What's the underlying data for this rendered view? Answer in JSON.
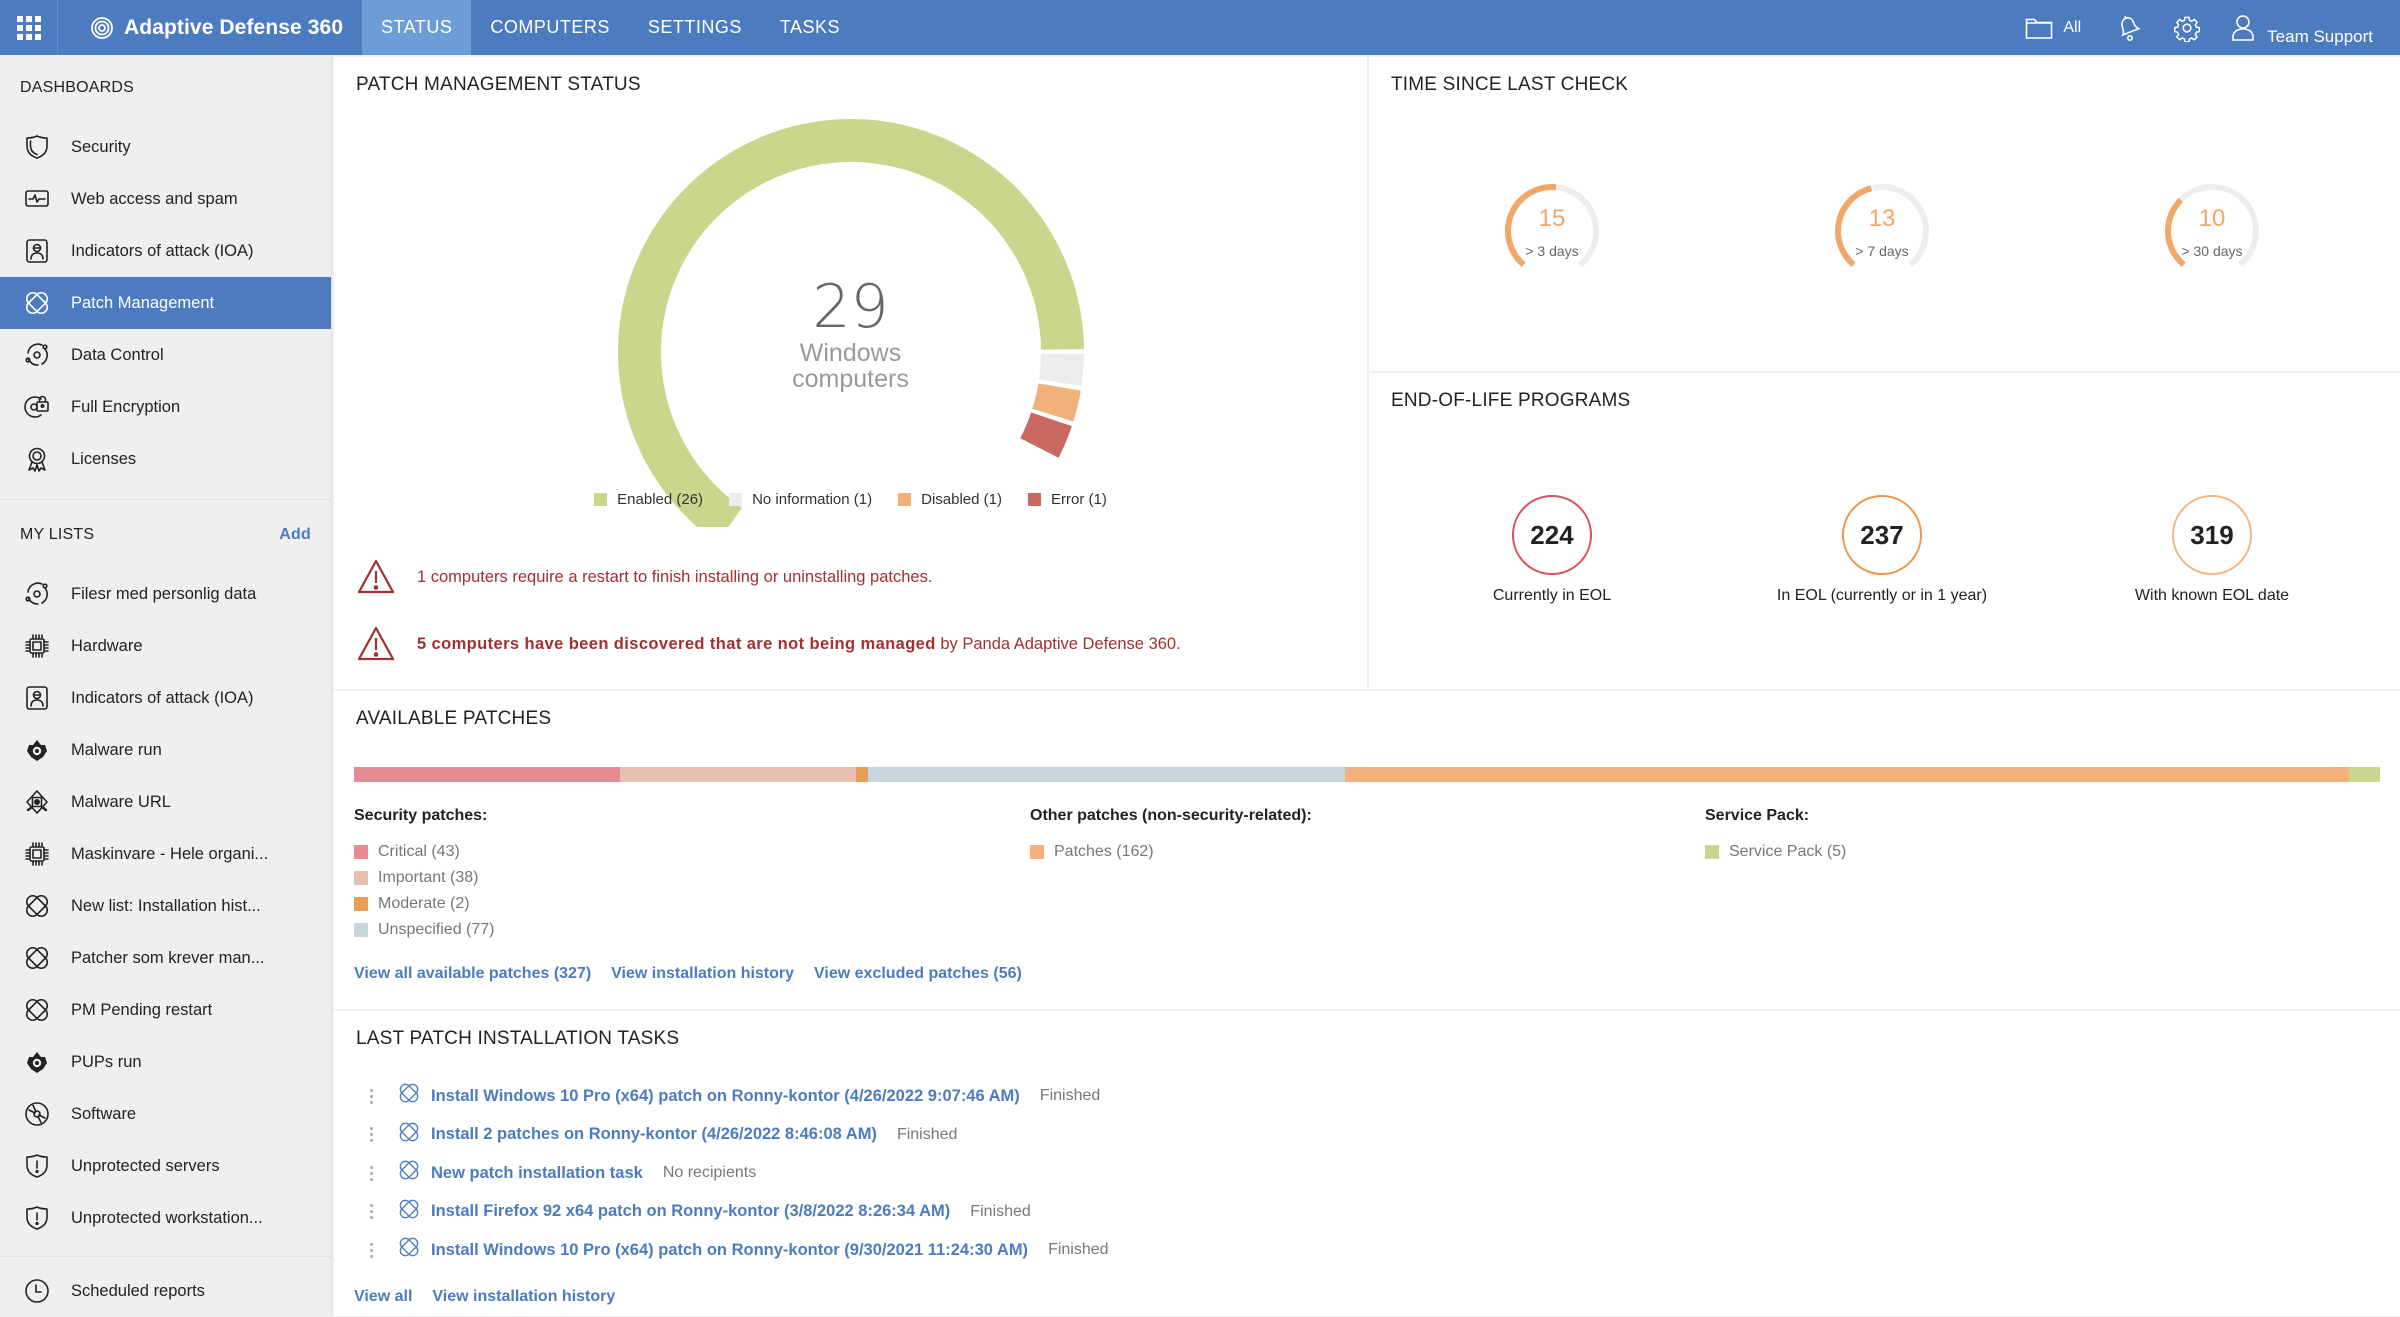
{
  "app": {
    "title": "Adaptive Defense 360",
    "nav_tabs": [
      {
        "label": "STATUS",
        "active": true
      },
      {
        "label": "COMPUTERS",
        "active": false
      },
      {
        "label": "SETTINGS",
        "active": false
      },
      {
        "label": "TASKS",
        "active": false
      }
    ],
    "filter_label": "All",
    "user_name": "Team Support",
    "accent_color": "#4c7cbf"
  },
  "sidebar": {
    "dashboards_title": "DASHBOARDS",
    "dashboards": [
      {
        "label": "Security",
        "icon": "shield-icon"
      },
      {
        "label": "Web access and spam",
        "icon": "monitor-pulse-icon"
      },
      {
        "label": "Indicators of attack (IOA)",
        "icon": "hacker-icon"
      },
      {
        "label": "Patch Management",
        "icon": "patch-icon",
        "active": true
      },
      {
        "label": "Data Control",
        "icon": "data-orbit-icon"
      },
      {
        "label": "Full Encryption",
        "icon": "disk-lock-icon"
      },
      {
        "label": "Licenses",
        "icon": "award-icon"
      }
    ],
    "lists_title": "MY LISTS",
    "lists_add": "Add",
    "lists": [
      {
        "label": "Filesr med personlig data",
        "icon": "data-orbit-icon"
      },
      {
        "label": "Hardware",
        "icon": "chip-icon"
      },
      {
        "label": "Indicators of attack (IOA)",
        "icon": "hacker-icon"
      },
      {
        "label": "Malware run",
        "icon": "malware-icon"
      },
      {
        "label": "Malware URL",
        "icon": "malware-url-icon"
      },
      {
        "label": "Maskinvare - Hele organi...",
        "icon": "chip-icon"
      },
      {
        "label": "New list: Installation hist...",
        "icon": "patch-icon"
      },
      {
        "label": "Patcher som krever man...",
        "icon": "patch-icon"
      },
      {
        "label": "PM Pending restart",
        "icon": "patch-icon"
      },
      {
        "label": "PUPs run",
        "icon": "malware-icon"
      },
      {
        "label": "Software",
        "icon": "disc-icon"
      },
      {
        "label": "Unprotected servers",
        "icon": "shield-alert-icon"
      },
      {
        "label": "Unprotected workstation...",
        "icon": "shield-alert-icon"
      }
    ],
    "scheduled_reports": {
      "label": "Scheduled reports",
      "icon": "clock-icon"
    }
  },
  "patch_status": {
    "title": "PATCH MANAGEMENT STATUS",
    "total": "29",
    "total_label_1": "Windows",
    "total_label_2": "computers",
    "alerts": [
      {
        "text": "1 computers require a restart to finish installing or uninstalling patches."
      },
      {
        "bold": "5 computers have been discovered that are not being managed",
        "rest": " by Panda Adaptive Defense 360."
      }
    ]
  },
  "time_since_last_check": {
    "title": "TIME SINCE LAST CHECK",
    "items": [
      {
        "value": "15",
        "label": "> 3 days",
        "fraction": 0.52
      },
      {
        "value": "13",
        "label": "> 7 days",
        "fraction": 0.45
      },
      {
        "value": "10",
        "label": "> 30 days",
        "fraction": 0.34
      }
    ]
  },
  "eol": {
    "title": "END-OF-LIFE PROGRAMS",
    "items": [
      {
        "value": "224",
        "label": "Currently in EOL",
        "color": "#d9505f"
      },
      {
        "value": "237",
        "label": "In EOL (currently or in 1 year)",
        "color": "#e8954f"
      },
      {
        "value": "319",
        "label": "With known EOL date",
        "color": "#f0b77e"
      }
    ]
  },
  "available_patches": {
    "title": "AVAILABLE PATCHES",
    "groups": [
      {
        "title": "Security patches:",
        "items": [
          {
            "label": "Critical (43)",
            "color": "#e68b92"
          },
          {
            "label": "Important (38)",
            "color": "#e6bfae"
          },
          {
            "label": "Moderate (2)",
            "color": "#e89d55"
          },
          {
            "label": "Unspecified (77)",
            "color": "#c7d6dc"
          }
        ]
      },
      {
        "title": "Other patches (non-security-related):",
        "items": [
          {
            "label": "Patches (162)",
            "color": "#f2b07a"
          }
        ]
      },
      {
        "title": "Service Pack:",
        "items": [
          {
            "label": "Service Pack (5)",
            "color": "#c9d78d"
          }
        ]
      }
    ],
    "links": [
      "View all available patches (327)",
      "View installation history",
      "View excluded patches (56)"
    ]
  },
  "last_tasks": {
    "title": "LAST PATCH INSTALLATION TASKS",
    "tasks": [
      {
        "name": "Install Windows 10 Pro (x64) patch on Ronny-kontor (4/26/2022 9:07:46 AM)",
        "status": "Finished"
      },
      {
        "name": "Install 2 patches on Ronny-kontor (4/26/2022 8:46:08 AM)",
        "status": "Finished"
      },
      {
        "name": "New patch installation task",
        "status": "No recipients"
      },
      {
        "name": "Install Firefox 92 x64 patch on Ronny-kontor (3/8/2022 8:26:34 AM)",
        "status": "Finished"
      },
      {
        "name": "Install Windows 10 Pro (x64) patch on Ronny-kontor (9/30/2021 11:24:30 AM)",
        "status": "Finished"
      }
    ],
    "links": [
      "View all",
      "View installation history"
    ]
  },
  "chart_data": [
    {
      "type": "pie",
      "title": "PATCH MANAGEMENT STATUS",
      "center_value": 29,
      "center_label": "Windows computers",
      "categories": [
        "Enabled",
        "No information",
        "Disabled",
        "Error"
      ],
      "values": [
        26,
        1,
        1,
        1
      ],
      "colors": [
        "#c9d78d",
        "#ececec",
        "#f2b07a",
        "#c8685f"
      ],
      "legend": [
        "Enabled (26)",
        "No information (1)",
        "Disabled (1)",
        "Error (1)"
      ],
      "legend_position": "bottom"
    },
    {
      "type": "bar",
      "title": "AVAILABLE PATCHES",
      "orientation": "stacked-horizontal",
      "categories": [
        "Critical",
        "Important",
        "Moderate",
        "Unspecified",
        "Patches",
        "Service Pack"
      ],
      "values": [
        43,
        38,
        2,
        77,
        162,
        5
      ],
      "colors": [
        "#e68b92",
        "#e6bfae",
        "#e89d55",
        "#c7d6dc",
        "#f2b07a",
        "#c9d78d"
      ]
    }
  ]
}
